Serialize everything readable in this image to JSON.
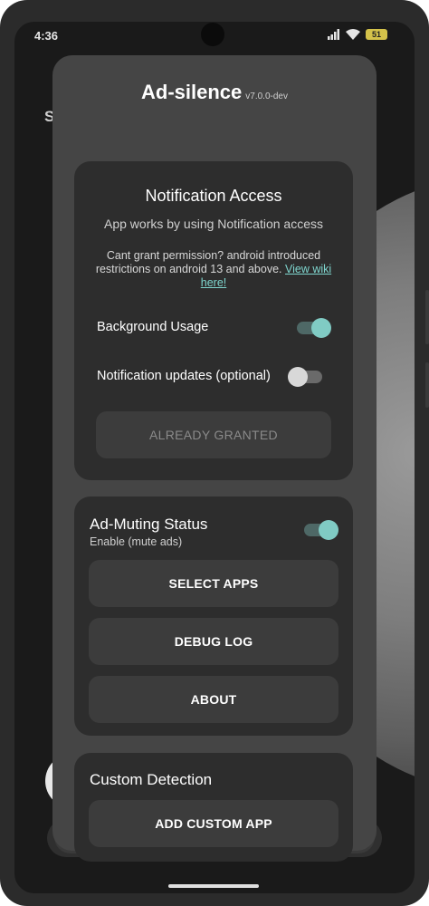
{
  "status_bar": {
    "time": "4:36",
    "battery": "51"
  },
  "dialog": {
    "title": "Ad-silence",
    "version": "v7.0.0-dev"
  },
  "notification_card": {
    "title": "Notification Access",
    "subtitle": "App works by using Notification access",
    "note": "Cant grant permission? android introduced restrictions on android 13 and above.",
    "link_text": "View wiki here!",
    "background_usage_label": "Background Usage",
    "background_usage_on": true,
    "notification_updates_label": "Notification updates (optional)",
    "notification_updates_on": false,
    "granted_button": "ALREADY GRANTED"
  },
  "muting_card": {
    "title": "Ad-Muting Status",
    "subtitle": "Enable (mute ads)",
    "enabled": true,
    "buttons": [
      "SELECT APPS",
      "DEBUG LOG",
      "ABOUT"
    ]
  },
  "custom_card": {
    "title": "Custom Detection",
    "button": "ADD CUSTOM APP"
  },
  "background": {
    "partial_letter": "S"
  },
  "colors": {
    "accent": "#80cbc4",
    "dialog_bg": "#454545",
    "card_bg": "#2d2d2d",
    "button_bg": "#3c3c3c"
  }
}
